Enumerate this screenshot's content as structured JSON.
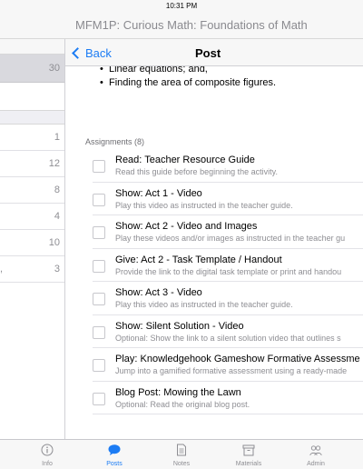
{
  "status_bar": {
    "time": "10:31 PM"
  },
  "app_title": "MFM1P: Curious Math: Foundations of Math",
  "nav": {
    "back_label": "Back",
    "title": "Post"
  },
  "left_list": {
    "selected_count": "30",
    "rows": [
      {
        "count": "1"
      },
      {
        "count": "12"
      },
      {
        "count": "8"
      },
      {
        "count": "4"
      },
      {
        "count": "10"
      },
      {
        "count": "3",
        "prefix": ","
      }
    ]
  },
  "objectives": [
    "Linear equations; and,",
    "Finding the area of composite figures."
  ],
  "assignments": {
    "header": "Assignments (8)",
    "items": [
      {
        "title": "Read: Teacher Resource Guide",
        "subtitle": "Read this guide before beginning the activity."
      },
      {
        "title": "Show: Act 1 - Video",
        "subtitle": "Play this video as instructed in the teacher guide."
      },
      {
        "title": "Show: Act 2 - Video and Images",
        "subtitle": "Play these videos and/or images as instructed in the teacher gu"
      },
      {
        "title": "Give: Act 2 - Task Template / Handout",
        "subtitle": "Provide the link to the digital task template or print and handou"
      },
      {
        "title": "Show: Act 3 - Video",
        "subtitle": "Play this video as instructed in the teacher guide."
      },
      {
        "title": "Show: Silent Solution - Video",
        "subtitle": "Optional: Show the link to a silent solution video that outlines s"
      },
      {
        "title": "Play: Knowledgehook Gameshow Formative Assessme",
        "subtitle": "Jump into a gamified formative assessment using a ready-made"
      },
      {
        "title": "Blog Post: Mowing the Lawn",
        "subtitle": "Optional: Read the original blog post."
      }
    ]
  },
  "tabs": [
    {
      "label": "Info",
      "icon": "info-icon"
    },
    {
      "label": "Posts",
      "icon": "speech-bubble-icon",
      "active": true
    },
    {
      "label": "Notes",
      "icon": "note-icon"
    },
    {
      "label": "Materials",
      "icon": "materials-icon"
    },
    {
      "label": "Admin",
      "icon": "people-icon"
    }
  ],
  "colors": {
    "accent": "#1c7cf4",
    "inactive": "#8e8e93"
  }
}
